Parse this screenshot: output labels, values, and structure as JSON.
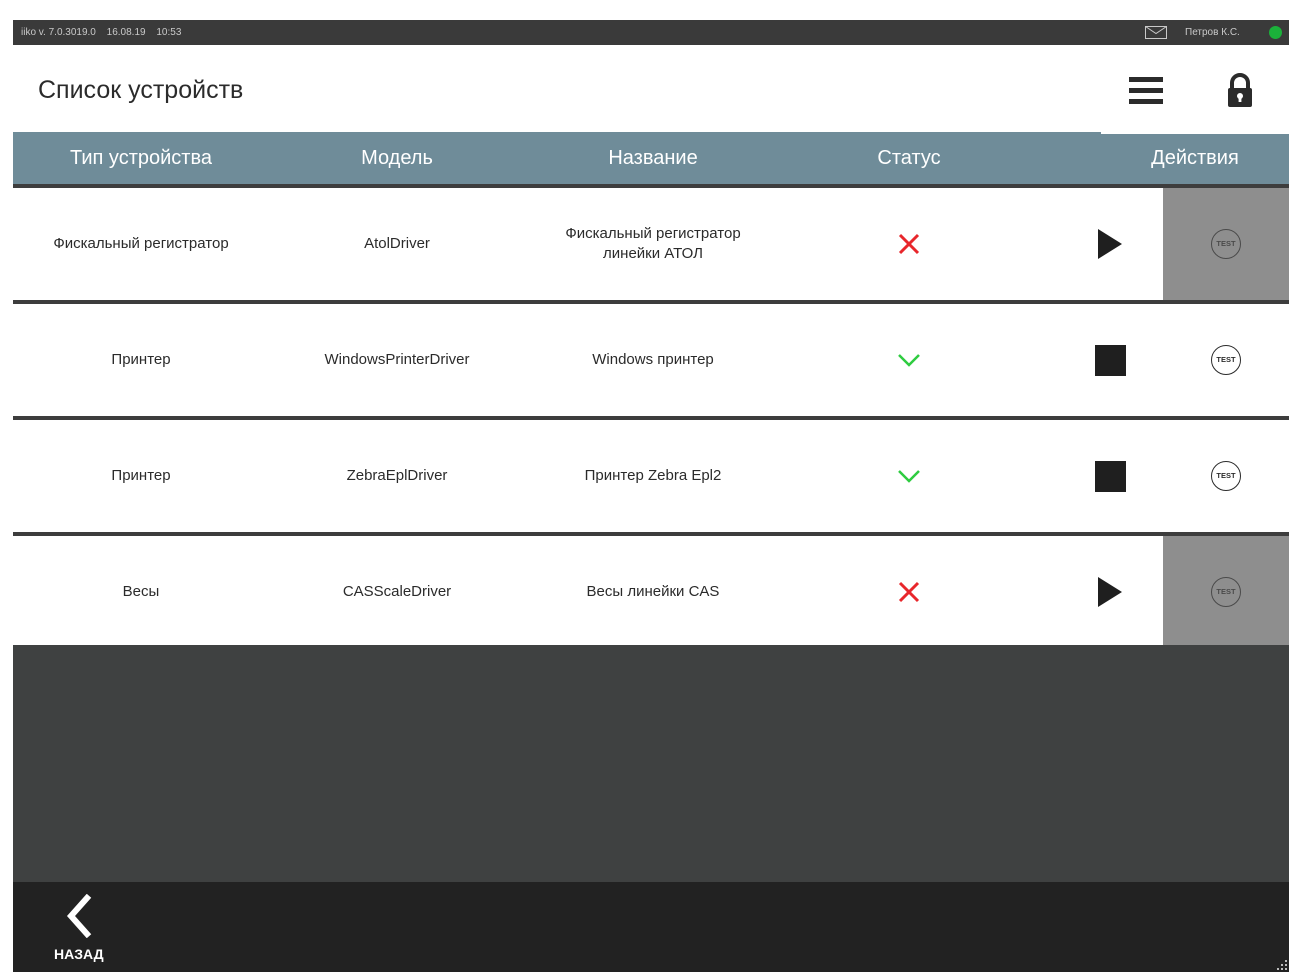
{
  "statusbar": {
    "version": "iiko v. 7.0.3019.0",
    "date": "16.08.19",
    "time": "10:53",
    "user": "Петров К.С.",
    "online_color": "#1bb13a"
  },
  "header": {
    "title": "Список устройств",
    "menu_icon": "hamburger-menu-icon",
    "lock_icon": "lock-icon"
  },
  "table": {
    "columns": [
      "Тип устройства",
      "Модель",
      "Название",
      "Статус",
      "Действия"
    ],
    "rows": [
      {
        "type": "Фискальный регистратор",
        "model": "AtolDriver",
        "name_line1": "Фискальный регистратор",
        "name_line2": "линейки АТОЛ",
        "status": "error",
        "action": "start",
        "test_enabled": false,
        "test_label": "TEST"
      },
      {
        "type": "Принтер",
        "model": "WindowsPrinterDriver",
        "name_line1": "Windows принтер",
        "name_line2": "",
        "status": "ok",
        "action": "stop",
        "test_enabled": true,
        "test_label": "TEST"
      },
      {
        "type": "Принтер",
        "model": "ZebraEplDriver",
        "name_line1": "Принтер Zebra Epl2",
        "name_line2": "",
        "status": "ok",
        "action": "stop",
        "test_enabled": true,
        "test_label": "TEST"
      },
      {
        "type": "Весы",
        "model": "CASScaleDriver",
        "name_line1": "Весы линейки CAS",
        "name_line2": "",
        "status": "error",
        "action": "start",
        "test_enabled": false,
        "test_label": "TEST"
      }
    ]
  },
  "footer": {
    "back_label": "НАЗАД"
  },
  "colors": {
    "header_bg": "#6f8c99",
    "ok": "#2ecc40",
    "error": "#e8262b",
    "disabled_cell": "#8e8e8e"
  }
}
